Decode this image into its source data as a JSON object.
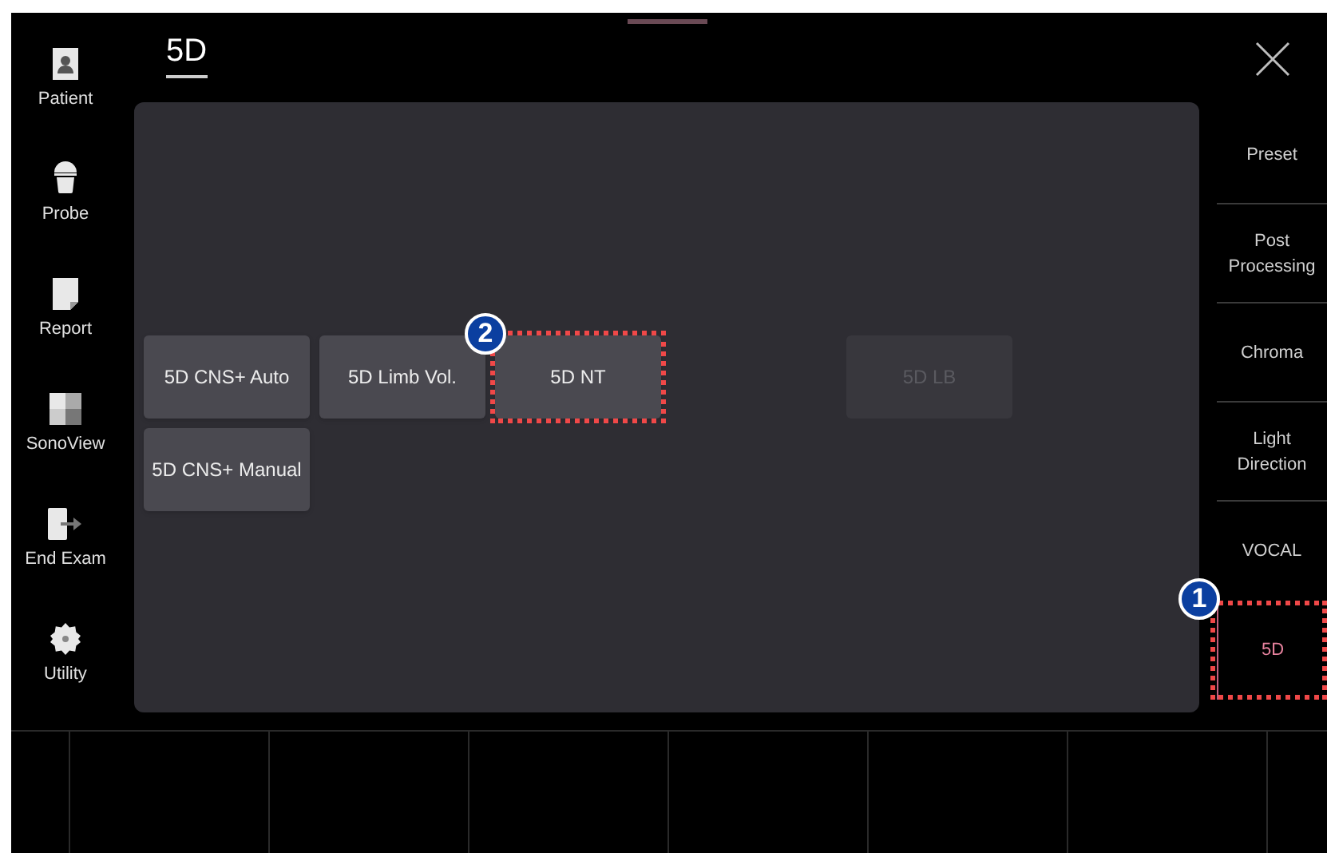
{
  "sidebar": {
    "items": [
      {
        "kind": "patient",
        "label": "Patient"
      },
      {
        "kind": "probe",
        "label": "Probe"
      },
      {
        "kind": "report",
        "label": "Report"
      },
      {
        "kind": "sonoview",
        "label": "SonoView"
      },
      {
        "kind": "endexam",
        "label": "End Exam"
      },
      {
        "kind": "utility",
        "label": "Utility"
      }
    ]
  },
  "title": "5D",
  "panel": {
    "rows": [
      [
        {
          "label": "5D CNS+ Auto",
          "disabled": false
        },
        {
          "label": "5D Limb Vol.",
          "disabled": false
        },
        {
          "label": "5D NT",
          "disabled": false,
          "callout": "2"
        },
        null,
        {
          "label": "5D LB",
          "disabled": true
        }
      ],
      [
        {
          "label": "5D CNS+ Manual",
          "disabled": false
        }
      ]
    ]
  },
  "right_menu": {
    "items": [
      {
        "label": "Preset",
        "selected": false
      },
      {
        "label": "Post Processing",
        "selected": false
      },
      {
        "label": "Chroma",
        "selected": false
      },
      {
        "label": "Light Direction",
        "selected": false
      },
      {
        "label": "VOCAL",
        "selected": false
      },
      {
        "label": "5D",
        "selected": true,
        "callout": "1"
      }
    ]
  }
}
